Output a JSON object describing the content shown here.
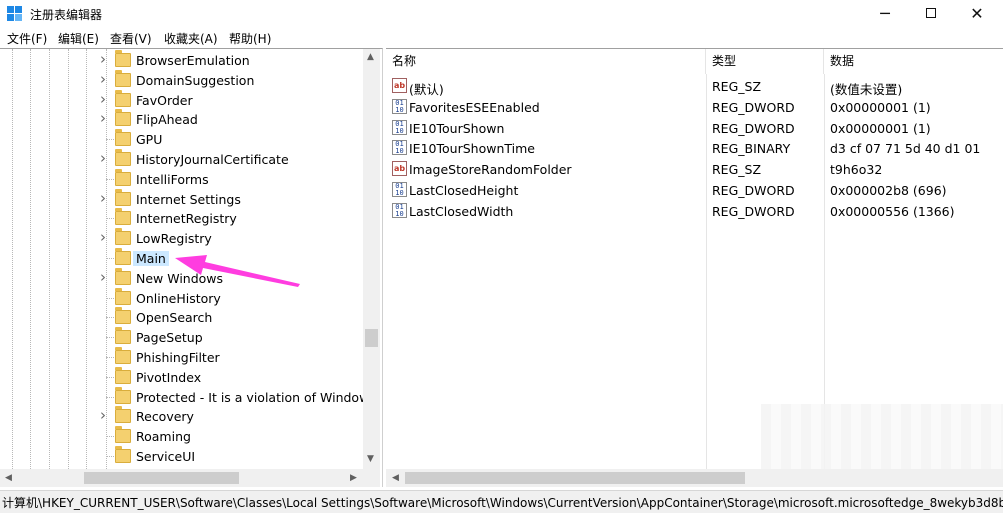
{
  "window": {
    "title": "注册表编辑器",
    "minimize": "─",
    "close": "✕"
  },
  "menu": [
    "文件(F)",
    "编辑(E)",
    "查看(V)",
    "收藏夹(A)",
    "帮助(H)"
  ],
  "tree": {
    "selected_index": 10,
    "items": [
      {
        "label": "BrowserEmulation",
        "expandable": true
      },
      {
        "label": "DomainSuggestion",
        "expandable": true
      },
      {
        "label": "FavOrder",
        "expandable": true
      },
      {
        "label": "FlipAhead",
        "expandable": true
      },
      {
        "label": "GPU",
        "expandable": false
      },
      {
        "label": "HistoryJournalCertificate",
        "expandable": true
      },
      {
        "label": "IntelliForms",
        "expandable": false
      },
      {
        "label": "Internet Settings",
        "expandable": true
      },
      {
        "label": "InternetRegistry",
        "expandable": false
      },
      {
        "label": "LowRegistry",
        "expandable": true
      },
      {
        "label": "Main",
        "expandable": false
      },
      {
        "label": "New Windows",
        "expandable": true
      },
      {
        "label": "OnlineHistory",
        "expandable": false
      },
      {
        "label": "OpenSearch",
        "expandable": false
      },
      {
        "label": "PageSetup",
        "expandable": false
      },
      {
        "label": "PhishingFilter",
        "expandable": false
      },
      {
        "label": "PivotIndex",
        "expandable": false
      },
      {
        "label": "Protected - It is a violation of Windows",
        "expandable": false
      },
      {
        "label": "Recovery",
        "expandable": true
      },
      {
        "label": "Roaming",
        "expandable": false
      },
      {
        "label": "ServiceUI",
        "expandable": false
      }
    ]
  },
  "values": {
    "columns": [
      "名称",
      "类型",
      "数据"
    ],
    "rows": [
      {
        "icon": "string-value-icon",
        "name": "(默认)",
        "type": "REG_SZ",
        "data": "(数值未设置)"
      },
      {
        "icon": "binary-value-icon",
        "name": "FavoritesESEEnabled",
        "type": "REG_DWORD",
        "data": "0x00000001 (1)"
      },
      {
        "icon": "binary-value-icon",
        "name": "IE10TourShown",
        "type": "REG_DWORD",
        "data": "0x00000001 (1)"
      },
      {
        "icon": "binary-value-icon",
        "name": "IE10TourShownTime",
        "type": "REG_BINARY",
        "data": "d3 cf 07 71 5d 40 d1 01"
      },
      {
        "icon": "string-value-icon",
        "name": "ImageStoreRandomFolder",
        "type": "REG_SZ",
        "data": "t9h6o32"
      },
      {
        "icon": "binary-value-icon",
        "name": "LastClosedHeight",
        "type": "REG_DWORD",
        "data": "0x000002b8 (696)"
      },
      {
        "icon": "binary-value-icon",
        "name": "LastClosedWidth",
        "type": "REG_DWORD",
        "data": "0x00000556 (1366)"
      }
    ]
  },
  "status_path": "计算机\\HKEY_CURRENT_USER\\Software\\Classes\\Local Settings\\Software\\Microsoft\\Windows\\CurrentVersion\\AppContainer\\Storage\\microsoft.microsoftedge_8wekyb3d8b",
  "colors": {
    "annotation_arrow": "#ff3de0",
    "selection": "#cce8ff",
    "folder": "#f4d06f"
  }
}
